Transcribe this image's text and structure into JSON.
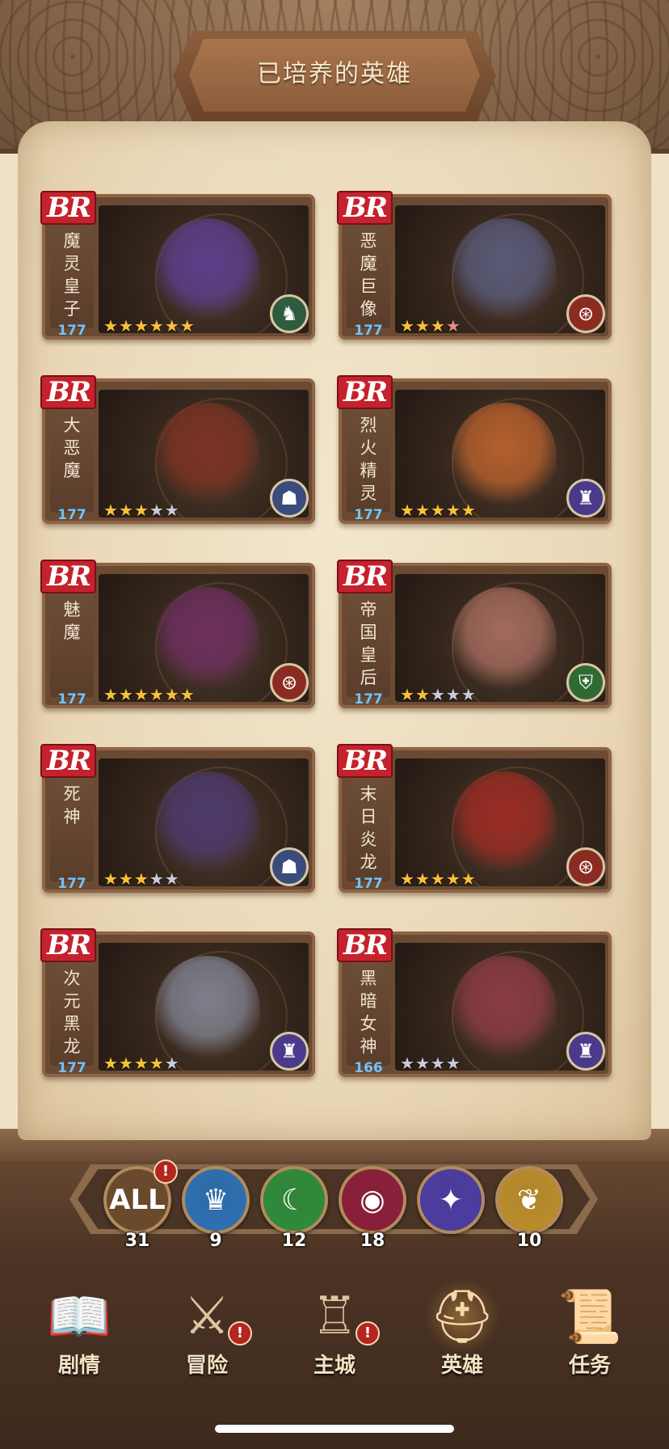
{
  "header": {
    "title": "已培养的英雄"
  },
  "heroes": [
    {
      "badge": "BR",
      "name": "魔灵皇子",
      "level": "177",
      "stars_gold": 6,
      "stars_silver": 0,
      "stars_red": 0,
      "class_icon": "horse-icon",
      "art_color": "#5b3f8c"
    },
    {
      "badge": "BR",
      "name": "恶魔巨像",
      "level": "177",
      "stars_gold": 3,
      "stars_silver": 0,
      "stars_red": 1,
      "class_icon": "cannon-icon",
      "art_color": "#595a78"
    },
    {
      "badge": "BR",
      "name": "大恶魔",
      "level": "177",
      "stars_gold": 3,
      "stars_silver": 2,
      "stars_red": 0,
      "class_icon": "hooded-icon",
      "art_color": "#7b3324"
    },
    {
      "badge": "BR",
      "name": "烈火精灵",
      "level": "177",
      "stars_gold": 5,
      "stars_silver": 0,
      "stars_red": 0,
      "class_icon": "helmet-icon",
      "art_color": "#b45f2c"
    },
    {
      "badge": "BR",
      "name": "魅魔",
      "level": "177",
      "stars_gold": 6,
      "stars_silver": 0,
      "stars_red": 0,
      "class_icon": "cannon-icon",
      "art_color": "#6d2f5f"
    },
    {
      "badge": "BR",
      "name": "帝国皇后",
      "level": "177",
      "stars_gold": 2,
      "stars_silver": 3,
      "stars_red": 0,
      "class_icon": "knight-icon",
      "art_color": "#a26a5c"
    },
    {
      "badge": "BR",
      "name": "死神",
      "level": "177",
      "stars_gold": 3,
      "stars_silver": 2,
      "stars_red": 0,
      "class_icon": "hooded-icon",
      "art_color": "#4d3a6c"
    },
    {
      "badge": "BR",
      "name": "末日炎龙",
      "level": "177",
      "stars_gold": 5,
      "stars_silver": 0,
      "stars_red": 0,
      "class_icon": "cannon-icon",
      "art_color": "#9a2c24"
    },
    {
      "badge": "BR",
      "name": "次元黑龙",
      "level": "177",
      "stars_gold": 4,
      "stars_silver": 1,
      "stars_red": 0,
      "class_icon": "helmet-icon",
      "art_color": "#7e7f8c"
    },
    {
      "badge": "BR",
      "name": "黑暗女神",
      "level": "166",
      "stars_gold": 0,
      "stars_silver": 4,
      "stars_red": 0,
      "class_icon": "helmet-icon",
      "art_color": "#8c3c44"
    }
  ],
  "filters": [
    {
      "label": "ALL",
      "count": "31",
      "icon": "all-icon",
      "alert": "!"
    },
    {
      "label": "",
      "count": "9",
      "icon": "crown-icon",
      "alert": ""
    },
    {
      "label": "",
      "count": "12",
      "icon": "moon-icon",
      "alert": ""
    },
    {
      "label": "",
      "count": "18",
      "icon": "eye-icon",
      "alert": ""
    },
    {
      "label": "",
      "count": "",
      "icon": "spirit-icon",
      "alert": ""
    },
    {
      "label": "",
      "count": "10",
      "icon": "wings-icon",
      "alert": ""
    }
  ],
  "nav": [
    {
      "label": "剧情",
      "icon": "book-icon",
      "alert": ""
    },
    {
      "label": "冒险",
      "icon": "swords-icon",
      "alert": "!"
    },
    {
      "label": "主城",
      "icon": "castle-icon",
      "alert": "!"
    },
    {
      "label": "英雄",
      "icon": "knight-helmet-icon",
      "alert": ""
    },
    {
      "label": "任务",
      "icon": "scroll-icon",
      "alert": ""
    }
  ],
  "colors": {
    "filter_all": "#6b4a2c",
    "filter_crown": "#2d6fb0",
    "filter_moon": "#2f8a3a",
    "filter_eye": "#8a1f3a",
    "filter_spirit": "#4c3ca0",
    "filter_wings": "#b88b2b"
  }
}
